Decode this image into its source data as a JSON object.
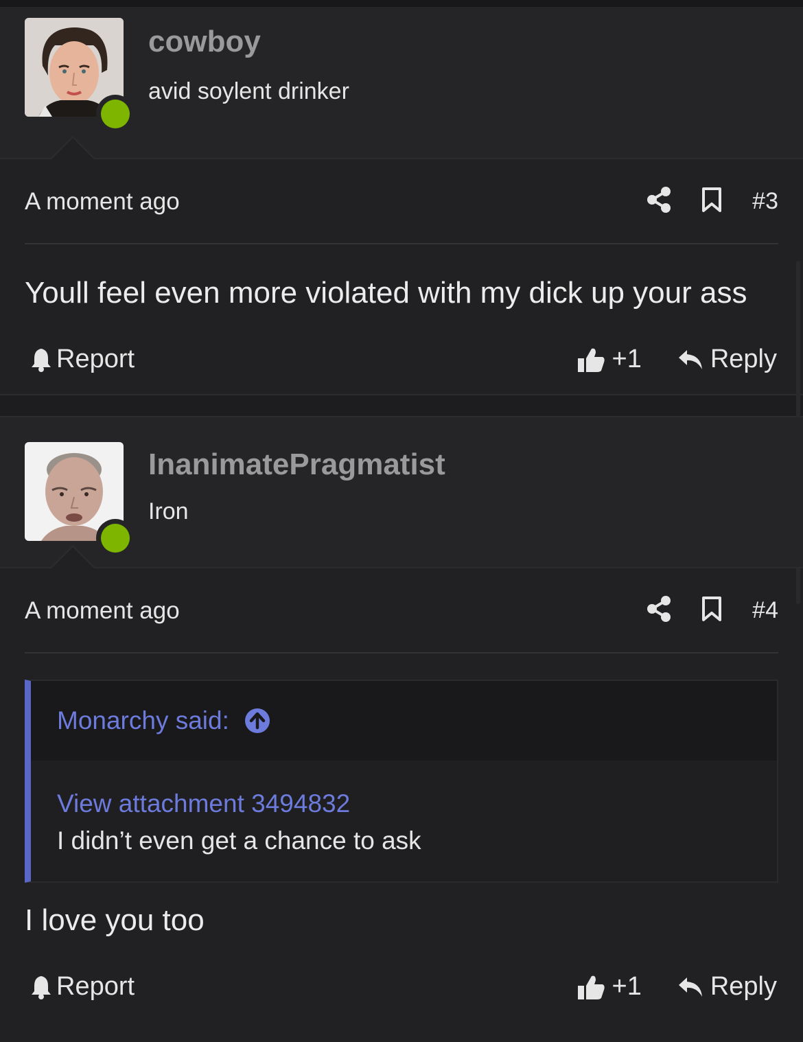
{
  "posts": [
    {
      "username": "cowboy",
      "user_title": "avid soylent drinker",
      "timestamp": "A moment ago",
      "post_number": "#3",
      "body": "Youll feel even more violated with my dick up your ass",
      "report_label": "Report",
      "like_count": "+1",
      "reply_label": "Reply"
    },
    {
      "username": "InanimatePragmatist",
      "user_title": "Iron",
      "timestamp": "A moment ago",
      "post_number": "#4",
      "quote": {
        "author_said": "Monarchy said:",
        "attachment_link": "View attachment 3494832",
        "text": "I didn’t even get a chance to ask"
      },
      "body": "I love you too",
      "report_label": "Report",
      "like_count": "+1",
      "reply_label": "Reply"
    }
  ],
  "colors": {
    "background": "#212123",
    "online": "#7db500",
    "quote_accent": "#5a67c9",
    "link": "#6c7bdc"
  },
  "icons": [
    "share-icon",
    "bookmark-icon",
    "bell-icon",
    "thumbs-up-icon",
    "reply-icon",
    "arrow-up-circle-icon"
  ]
}
